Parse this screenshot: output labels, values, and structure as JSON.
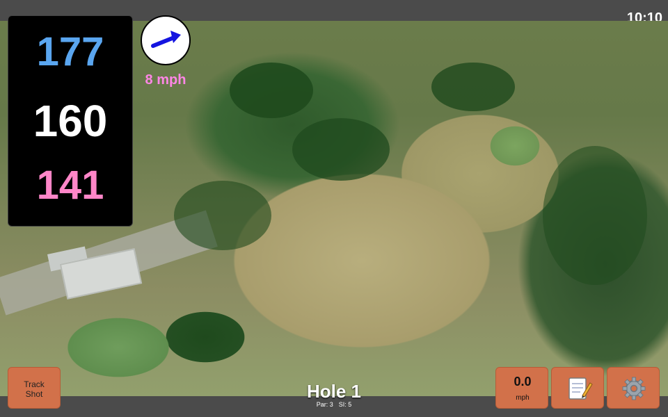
{
  "status": {
    "time": "10:10"
  },
  "distances": {
    "back": "177",
    "middle": "160",
    "front": "141"
  },
  "wind": {
    "speed_label": "8 mph",
    "direction_icon": "arrow-northeast-icon",
    "arrow_color": "#1414e0"
  },
  "buttons": {
    "track_shot_line1": "Track",
    "track_shot_line2": "Shot",
    "speed_value": "0.0",
    "speed_unit": "mph",
    "notes_icon": "notepad-icon",
    "settings_icon": "gear-icon"
  },
  "hole": {
    "title": "Hole 1",
    "par": "Par: 3",
    "si": "SI: 5"
  },
  "colors": {
    "back_distance": "#5aa6f0",
    "middle_distance": "#ffffff",
    "front_distance": "#ff86c8",
    "button": "#d2714a",
    "wind_text": "#ff86e6"
  }
}
